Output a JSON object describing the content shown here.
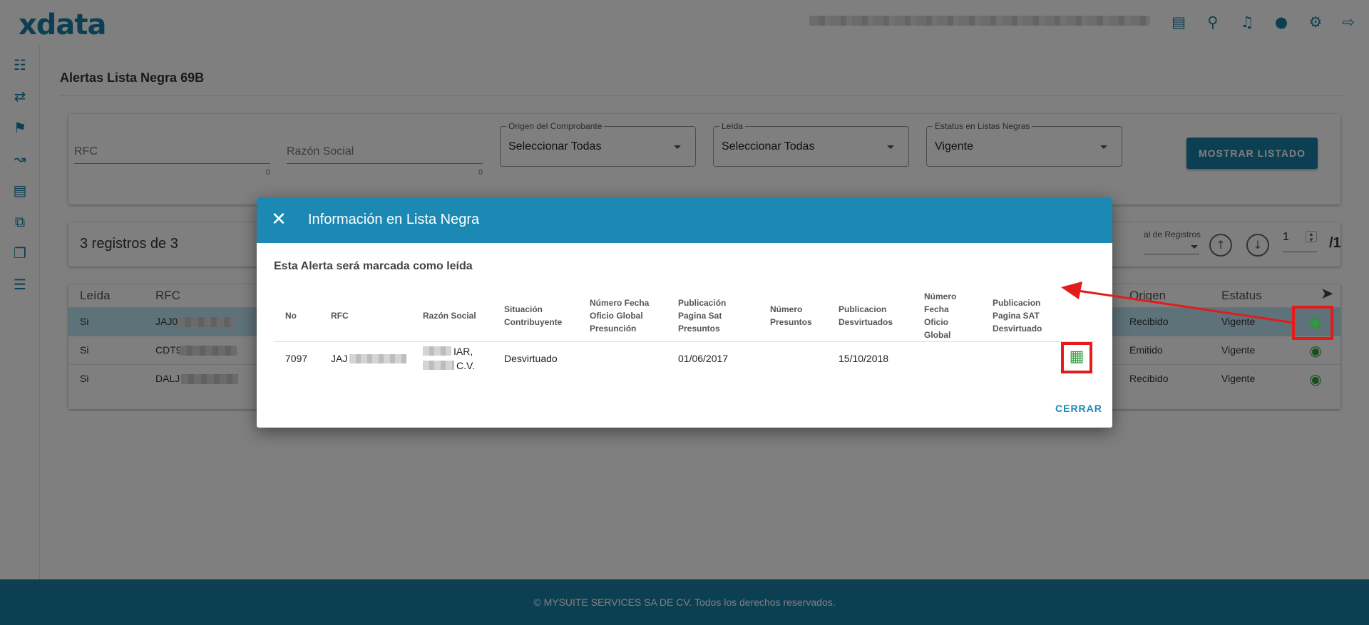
{
  "header": {
    "logo_text": "xdata",
    "user_blurred": "",
    "icons": [
      "card-icon",
      "search-icon",
      "bell-icon",
      "person-icon",
      "gear-icon",
      "logout-icon"
    ]
  },
  "sidebar": {
    "icons": [
      "library-icon",
      "compare-arrows-icon",
      "figure-icon",
      "chart-line-icon",
      "document-list-icon",
      "copy-search-icon",
      "library-books-icon",
      "list-icon"
    ]
  },
  "page": {
    "title": "Alertas Lista Negra 69B"
  },
  "filters": {
    "rfc_label": "RFC",
    "rfc_count": "0",
    "razon_label": "Razón Social",
    "razon_count": "0",
    "origen_label": "Origen del Comprobante",
    "origen_value": "Seleccionar Todas",
    "leida_label": "Leída",
    "leida_value": "Seleccionar Todas",
    "estatus_label": "Estatus en Listas Negras",
    "estatus_value": "Vigente",
    "show_button": "MOSTRAR LISTADO"
  },
  "summary": {
    "count_text": "3 registros de 3",
    "per_page_label": "al de Registros",
    "page_value": "1",
    "page_total": "/1"
  },
  "table": {
    "headers": {
      "leida": "Leída",
      "rfc": "RFC",
      "origen": "Origen",
      "estatus": "Estatus"
    },
    "rows": [
      {
        "leida": "Si",
        "rfc": "JAJ0",
        "origen": "Recibido",
        "estatus": "Vigente"
      },
      {
        "leida": "Si",
        "rfc": "CDT9",
        "origen": "Emitido",
        "estatus": "Vigente"
      },
      {
        "leida": "Si",
        "rfc": "DALJ",
        "origen": "Recibido",
        "estatus": "Vigente"
      }
    ]
  },
  "dialog": {
    "title": "Información en Lista Negra",
    "message": "Esta Alerta será marcada como leída",
    "headers": {
      "no": "No",
      "rfc": "RFC",
      "razon": "Razón Social",
      "situacion": "Situación Contribuyente",
      "num_fecha_presuncion": "Número Fecha Oficio Global Presunción",
      "pub_sat_presuntos": "Publicación Pagina Sat Presuntos",
      "num_presuntos": "Número Presuntos",
      "pub_desvirtuados": "Publicacion Desvirtuados",
      "num_fecha_global": "Número Fecha Oficio Global",
      "pub_sat_desvirtuado": "Publicacion Pagina SAT Desvirtuado"
    },
    "row": {
      "no": "7097",
      "rfc": "JAJ",
      "razon_line1": "IAR,",
      "razon_line2": "C.V.",
      "situacion": "Desvirtuado",
      "pub_sat_presuntos": "01/06/2017",
      "pub_desvirtuados": "15/10/2018"
    },
    "close_button": "CERRAR"
  },
  "footer": {
    "text": "© MYSUITE SERVICES SA DE CV. Todos los derechos reservados."
  },
  "colors": {
    "brand": "#1b7fa5",
    "dialog_header": "#1b89b4",
    "annotation_red": "#e31b1b",
    "icon_green": "#2e9e3a",
    "selected_row": "#bde5f3"
  }
}
